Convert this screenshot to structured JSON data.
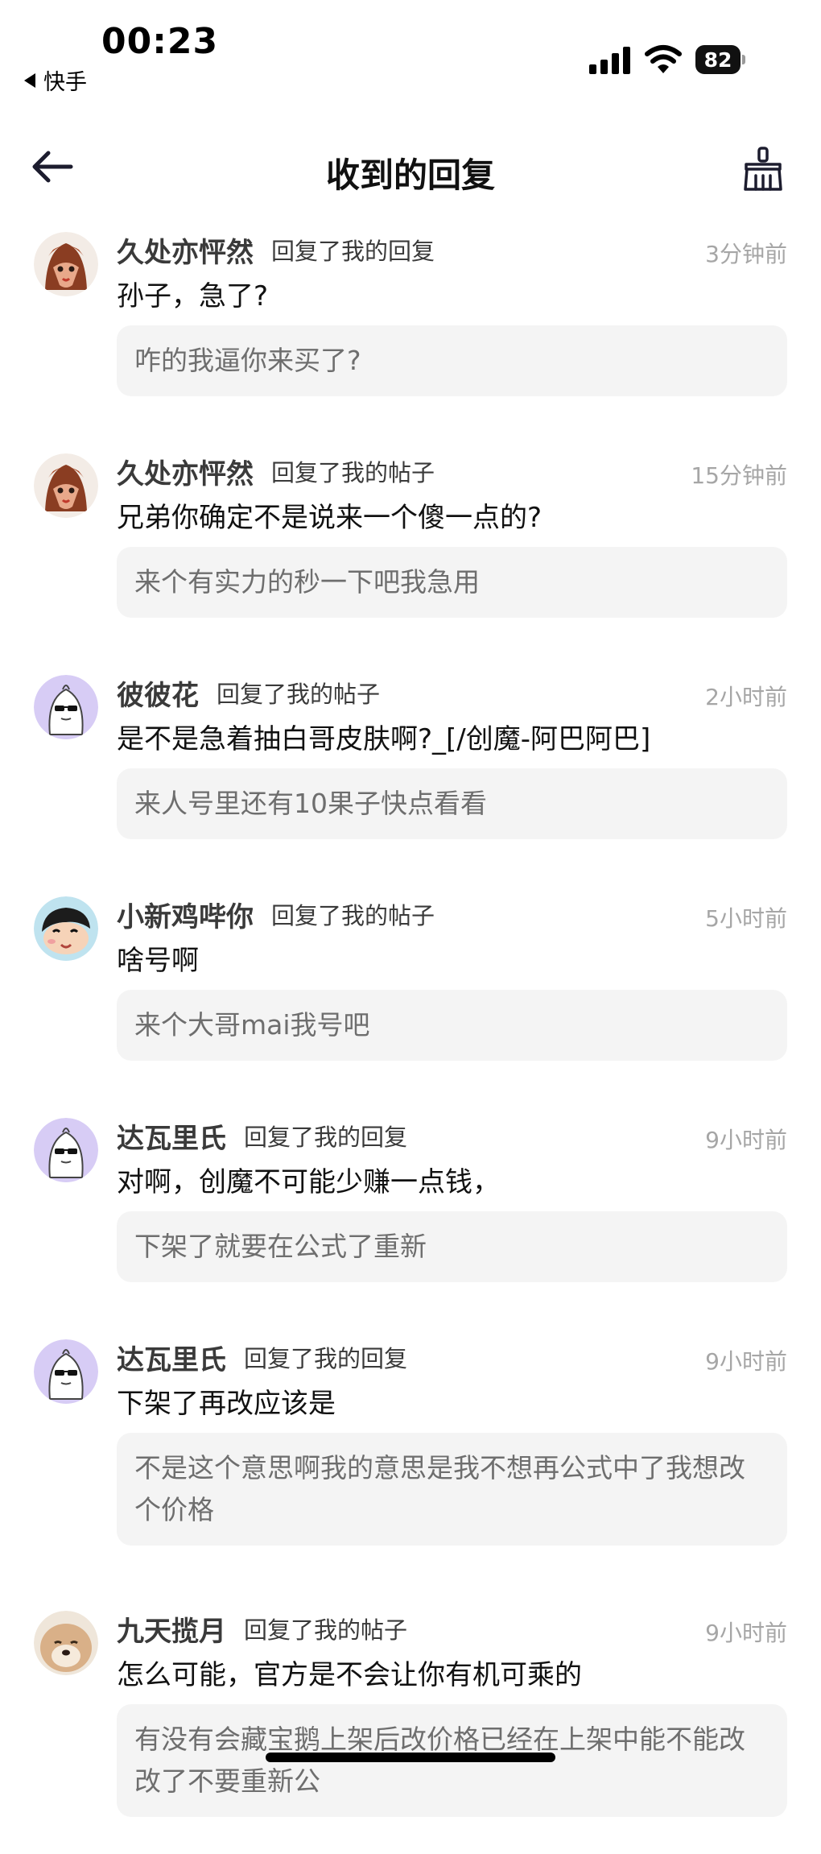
{
  "status_bar": {
    "time": "00:23",
    "back_app_label": "快手",
    "battery_level": "82"
  },
  "header": {
    "title": "收到的回复"
  },
  "replies": [
    {
      "user": "久处亦怦然",
      "action": "回复了我的回复",
      "time": "3分钟前",
      "text": "孙子，急了?",
      "quote": "咋的我逼你来买了?",
      "avatar": "fox-avatar"
    },
    {
      "user": "久处亦怦然",
      "action": "回复了我的帖子",
      "time": "15分钟前",
      "text": "兄弟你确定不是说来一个傻一点的?",
      "quote": "来个有实力的秒一下吧我急用",
      "avatar": "fox-avatar"
    },
    {
      "user": "彼彼花",
      "action": "回复了我的帖子",
      "time": "2小时前",
      "text": "是不是急着抽白哥皮肤啊?_[/创魔-阿巴阿巴]",
      "quote": "来人号里还有10果子快点看看",
      "avatar": "ghost-sunglasses-avatar"
    },
    {
      "user": "小新鸡哔你",
      "action": "回复了我的帖子",
      "time": "5小时前",
      "text": "啥号啊",
      "quote": "来个大哥mai我号吧",
      "avatar": "cartoon-boy-avatar"
    },
    {
      "user": "达瓦里氏",
      "action": "回复了我的回复",
      "time": "9小时前",
      "text": "对啊，创魔不可能少赚一点钱，",
      "quote": "下架了就要在公式了重新",
      "avatar": "ghost-sunglasses-avatar"
    },
    {
      "user": "达瓦里氏",
      "action": "回复了我的回复",
      "time": "9小时前",
      "text": "下架了再改应该是",
      "quote": "不是这个意思啊我的意思是我不想再公式中了我想改个价格",
      "avatar": "ghost-sunglasses-avatar"
    },
    {
      "user": "九天揽月",
      "action": "回复了我的帖子",
      "time": "9小时前",
      "text": "怎么可能，官方是不会让你有机可乘的",
      "quote": "有没有会藏宝鹅上架后改价格已经在上架中能不能改改了不要重新公",
      "avatar": "dog-avatar"
    }
  ]
}
